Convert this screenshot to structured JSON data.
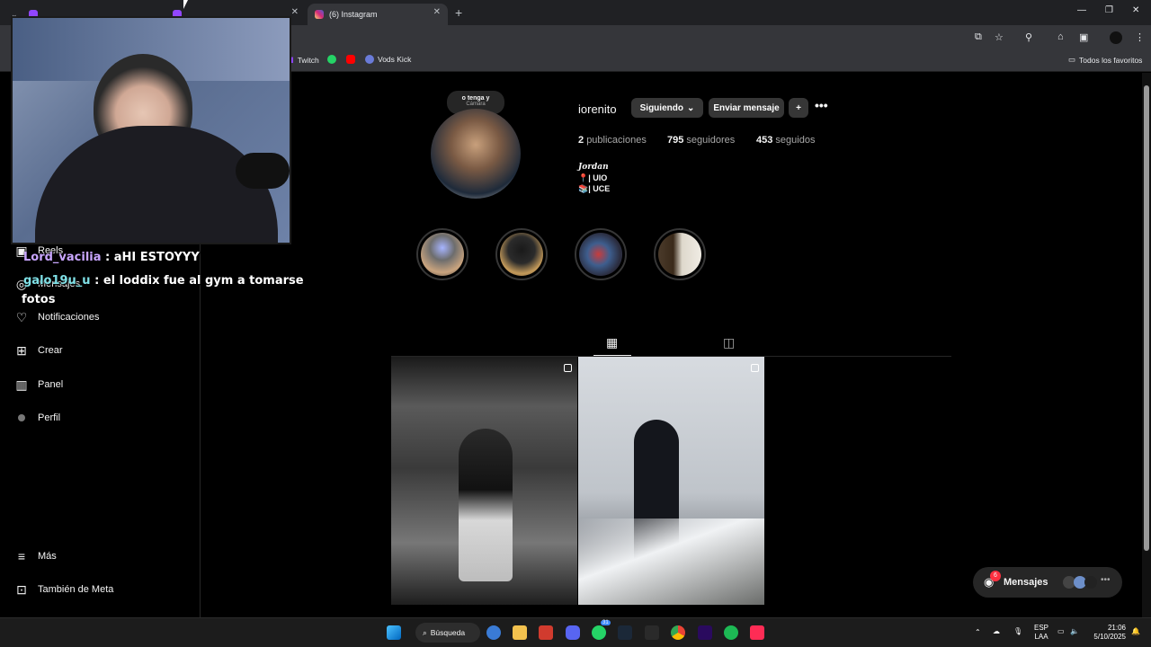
{
  "browser": {
    "tabs": [
      {
        "label": "",
        "active": false
      },
      {
        "label": "",
        "active": false
      },
      {
        "label": "(6) Instagram",
        "active": true
      }
    ],
    "bookmarks": [
      {
        "label": "Twitch",
        "icon": "twitch-icon"
      },
      {
        "label": "",
        "icon": "whatsapp-icon"
      },
      {
        "label": "",
        "icon": "youtube-icon"
      },
      {
        "label": "Vods Kick",
        "icon": "kick-icon"
      }
    ],
    "all_favorites": "Todos los favoritos",
    "accent": "#35363a"
  },
  "sidebar": {
    "items": [
      {
        "label": "Reels",
        "icon": "reels-icon"
      },
      {
        "label": "Mensajes",
        "icon": "messenger-icon",
        "badge": "6"
      },
      {
        "label": "Notificaciones",
        "icon": "heart-icon"
      },
      {
        "label": "Crear",
        "icon": "plus-square-icon"
      },
      {
        "label": "Panel",
        "icon": "chart-icon"
      },
      {
        "label": "Perfil",
        "icon": "avatar-icon"
      }
    ],
    "more": "Más",
    "meta": "También de Meta"
  },
  "chat": [
    {
      "user": "Lord_vacilia",
      "text": " : aHI ESTOYYY",
      "color": "#c9a6ff"
    },
    {
      "user": "galo19u_u",
      "text": " : el loddix fue al gym a tomarse",
      "cont": "fotos",
      "color": "#7fe0e6"
    }
  ],
  "profile": {
    "note": "o tenga y",
    "note_sub": "Cámara",
    "username": "iorenito",
    "follow_button": "Siguiendo",
    "message_button": "Enviar mensaje",
    "stats": [
      {
        "count": "2",
        "label": "publicaciones"
      },
      {
        "count": "795",
        "label": "seguidores"
      },
      {
        "count": "453",
        "label": "seguidos"
      }
    ],
    "bio": [
      "Jordan",
      "📍| UIO",
      "📚| UCE"
    ],
    "highlights_count": 4
  },
  "messages_pill": {
    "label": "Mensajes",
    "badge": "6"
  },
  "taskbar": {
    "search": "Búsqueda",
    "lang": "ESP",
    "lang_sub": "LAA",
    "time": "21:06",
    "date": "5/10/2025",
    "discord_badge": "31"
  }
}
